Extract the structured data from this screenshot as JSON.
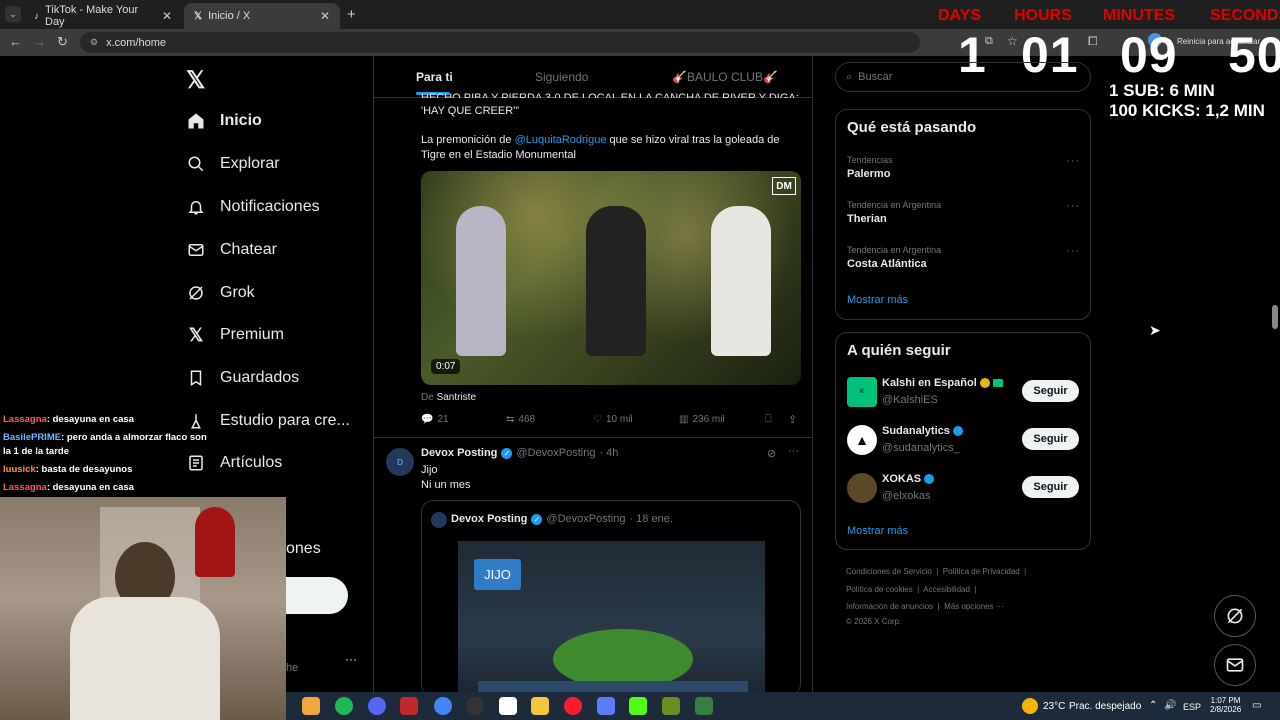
{
  "browser": {
    "tabs": [
      {
        "label": "TikTok - Make Your Day"
      },
      {
        "label": "Inicio / X"
      }
    ],
    "url": "x.com/home",
    "restart_hint": "Reinicia para actualizar"
  },
  "timer": {
    "labels": {
      "days": "DAYS",
      "hours": "HOURS",
      "minutes": "MINUTES",
      "seconds": "SECONDS"
    },
    "values": {
      "days": "1",
      "hours": "01",
      "minutes": "09",
      "seconds": "50"
    },
    "rule1": "1 SUB: 6 MIN",
    "rule2": "100 KICKS: 1,2 MIN",
    "colors": {
      "labels": "#e00000"
    }
  },
  "nav": {
    "items": [
      {
        "label": "Inicio",
        "icon": "home-icon"
      },
      {
        "label": "Explorar",
        "icon": "search-icon"
      },
      {
        "label": "Notificaciones",
        "icon": "bell-icon"
      },
      {
        "label": "Chatear",
        "icon": "mail-icon"
      },
      {
        "label": "Grok",
        "icon": "grok-icon"
      },
      {
        "label": "Premium",
        "icon": "x-logo-icon"
      },
      {
        "label": "Guardados",
        "icon": "bookmark-icon"
      },
      {
        "label": "Estudio para cre...",
        "icon": "creator-icon"
      },
      {
        "label": "Artículos",
        "icon": "article-icon"
      }
    ],
    "partial_label": "ones",
    "partial_label2": "he"
  },
  "feed": {
    "tabs": [
      "Para ti",
      "Siguiendo",
      "🎸BAULO CLUB🎸"
    ],
    "post1": {
      "headline": "\"HECHO PIBA Y PIERDA 3-0 DE LOCAL EN LA CANCHA DE RIVER Y DIGA: 'HAY QUE CREER'\"",
      "line1": "HECHO PIBA Y PIERDA 3-0 DE LOCAL EN LA CANCHA DE RIVER Y DIGA:",
      "line2": "'HAY QUE CREER'\"",
      "text_prefix": "La premonición de ",
      "mention": "@LuquitaRodrigue",
      "text_suffix": " que se hizo viral tras la goleada de",
      "text_line2": "Tigre en el Estadio Monumental",
      "video_time": "0:07",
      "video_logo": "DM",
      "from_prefix": "De ",
      "from_name": "Santriste",
      "replies": "21",
      "reposts": "468",
      "likes": "10 mil",
      "views": "236 mil"
    },
    "post2": {
      "name": "Devox Posting",
      "handle": "@DevoxPosting",
      "time": "· 4h",
      "line1": "Jijo",
      "line2": "Ni un mes",
      "quote": {
        "name": "Devox Posting",
        "handle": "@DevoxPosting",
        "time": "· 18 ene.",
        "badge": "JIJO"
      }
    }
  },
  "right": {
    "search_placeholder": "Buscar",
    "trends_title": "Qué está pasando",
    "trends": [
      {
        "category": "Tendencias",
        "name": "Palermo"
      },
      {
        "category": "Tendencia en Argentina",
        "name": "Therian"
      },
      {
        "category": "Tendencia en Argentina",
        "name": "Costa Atlántica"
      }
    ],
    "show_more": "Mostrar más",
    "follow_title": "A quién seguir",
    "follow": [
      {
        "name": "Kalshi en Español",
        "handle": "@KalshiES",
        "button": "Seguir"
      },
      {
        "name": "Sudanalytics",
        "handle": "@sudanalytics_",
        "button": "Seguir"
      },
      {
        "name": "XOKAS",
        "handle": "@elxokas",
        "button": "Seguir"
      }
    ],
    "footer": {
      "l1": "Condiciones de Servicio",
      "l2": "Política de Privacidad",
      "l3": "Política de cookies",
      "l4": "Accesibilidad",
      "l5": "Información de anuncios",
      "l6": "Más opciones ···",
      "copy": "© 2026 X Corp."
    }
  },
  "chat": [
    {
      "user": "Lassagna",
      "msg": ": desayuna en casa",
      "color": "#ff5a5a"
    },
    {
      "user": "BasilePRIME",
      "msg": ": pero anda a almorzar flaco son",
      "color": "#6cb6ff"
    },
    {
      "user": "",
      "msg": "la 1 de la tarde",
      "color": "#ffffff"
    },
    {
      "user": "luusick",
      "msg": ": basta de desayunos",
      "color": "#ff8c3a"
    },
    {
      "user": "Lassagna",
      "msg": ": desayuna en casa",
      "color": "#ff5a5a"
    }
  ],
  "taskbar": {
    "weather": "23°C",
    "weather_desc": "Prac. despejado",
    "lang": "ESP",
    "time": "1:07 PM",
    "date": "2/8/2026"
  },
  "colors": {
    "accent": "#1d9bf0",
    "bg": "#000000",
    "verified": "#1d9bf0",
    "gold": "#e2b719"
  }
}
